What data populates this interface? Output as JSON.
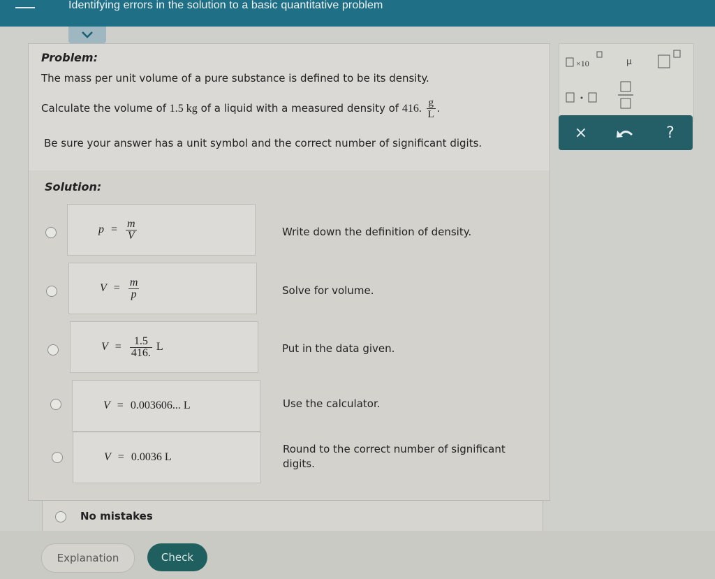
{
  "header": {
    "title": "Identifying errors in the solution to a basic quantitative problem"
  },
  "problem": {
    "label": "Problem:",
    "line1": "The mass per unit volume of a pure substance is defined to be its density.",
    "line2_pre": "Calculate the volume of",
    "mass_value": "1.5 kg",
    "line2_mid": "of a liquid with a measured density of",
    "density_value": "416.",
    "density_unit_num": "g",
    "density_unit_den": "L",
    "line2_end": ".",
    "line3": "Be sure your answer has a unit symbol and the correct number of significant digits."
  },
  "solution": {
    "label": "Solution:",
    "steps": [
      {
        "lhs": "p",
        "eq": "=",
        "num": "m",
        "den": "V",
        "text": "Write down the definition of density."
      },
      {
        "lhs": "V",
        "eq": "=",
        "num": "m",
        "den": "p",
        "text": "Solve for volume."
      },
      {
        "lhs": "V",
        "eq": "=",
        "num": "1.5",
        "den": "416.",
        "unit": "L",
        "text": "Put in the data given."
      },
      {
        "lhs": "V",
        "eq": "=",
        "rhs": "0.003606... L",
        "text": "Use the calculator."
      },
      {
        "lhs": "V",
        "eq": "=",
        "rhs": "0.0036 L",
        "text": "Round to the correct number of significant digits."
      }
    ],
    "no_mistakes": "No mistakes"
  },
  "buttons": {
    "explanation": "Explanation",
    "check": "Check"
  },
  "keypad": {
    "x10": "×10",
    "mu": "μ",
    "tools": {
      "clear": "×",
      "undo": "undo-icon",
      "help": "?"
    }
  },
  "colors": {
    "header": "#1f6f86",
    "check_button": "#1f5f5f",
    "tool_bar": "#245e66"
  }
}
